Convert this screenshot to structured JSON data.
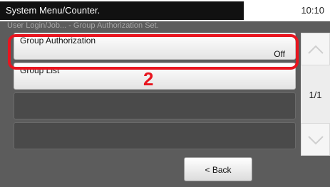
{
  "status_bar": {
    "title": "System Menu/Counter.",
    "time": "10:10"
  },
  "breadcrumb": "User Login/Job... - Group Authorization Set.",
  "list": [
    {
      "label": "Group Authorization",
      "value": "Off"
    },
    {
      "label": "Group List",
      "value": ""
    }
  ],
  "callout_number": "2",
  "pager": {
    "indicator": "1/1",
    "up_icon": "chevron-up-icon",
    "down_icon": "chevron-down-icon"
  },
  "footer": {
    "back_label": "< Back"
  },
  "colors": {
    "highlight": "#e8151f",
    "panel": "#5c5c5c",
    "title_bar": "#111111"
  }
}
